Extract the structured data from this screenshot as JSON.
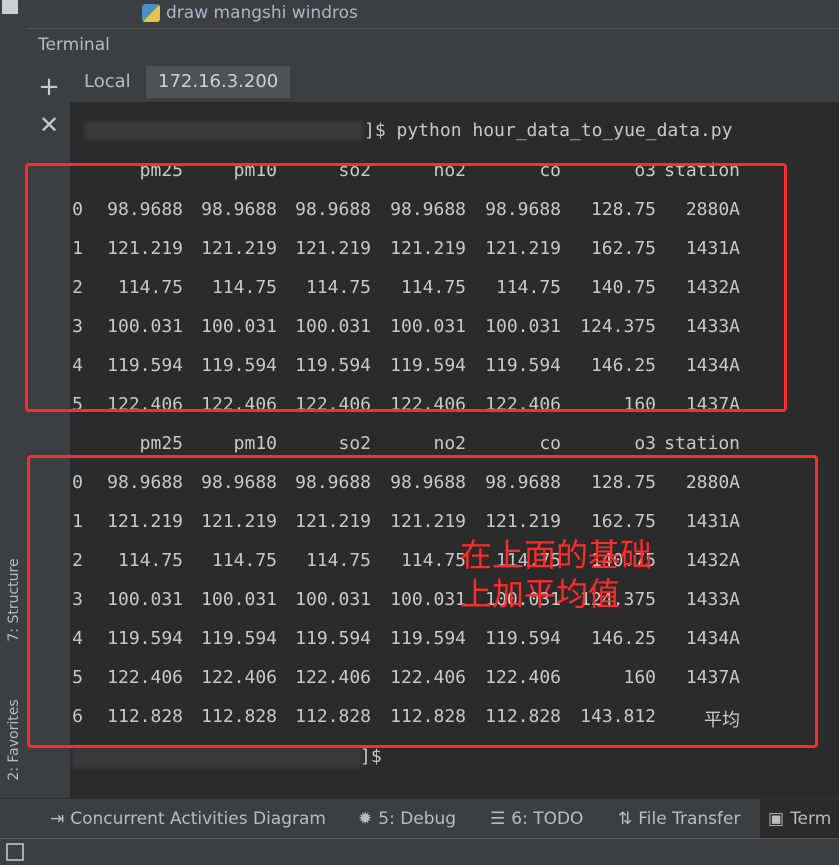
{
  "editor_tab": {
    "file": "draw mangshi windros"
  },
  "panel": {
    "title": "Terminal"
  },
  "side_labels": {
    "structure": "7: Structure",
    "favorites": "2: Favorites"
  },
  "tabs": [
    {
      "label": "Local"
    },
    {
      "label": "172.16.3.200"
    }
  ],
  "terminal": {
    "prompt_suffix": "]$",
    "command_line": "]$ python hour_data_to_yue_data.py",
    "columns": [
      "pm25",
      "pm10",
      "so2",
      "no2",
      "co",
      "o3",
      "station"
    ],
    "table1": [
      [
        "0",
        "98.9688",
        "98.9688",
        "98.9688",
        "98.9688",
        "98.9688",
        "128.75",
        "2880A"
      ],
      [
        "1",
        "121.219",
        "121.219",
        "121.219",
        "121.219",
        "121.219",
        "162.75",
        "1431A"
      ],
      [
        "2",
        "114.75",
        "114.75",
        "114.75",
        "114.75",
        "114.75",
        "140.75",
        "1432A"
      ],
      [
        "3",
        "100.031",
        "100.031",
        "100.031",
        "100.031",
        "100.031",
        "124.375",
        "1433A"
      ],
      [
        "4",
        "119.594",
        "119.594",
        "119.594",
        "119.594",
        "119.594",
        "146.25",
        "1434A"
      ],
      [
        "5",
        "122.406",
        "122.406",
        "122.406",
        "122.406",
        "122.406",
        "160",
        "1437A"
      ]
    ],
    "table2": [
      [
        "0",
        "98.9688",
        "98.9688",
        "98.9688",
        "98.9688",
        "98.9688",
        "128.75",
        "2880A"
      ],
      [
        "1",
        "121.219",
        "121.219",
        "121.219",
        "121.219",
        "121.219",
        "162.75",
        "1431A"
      ],
      [
        "2",
        "114.75",
        "114.75",
        "114.75",
        "114.75",
        "114.75",
        "140.75",
        "1432A"
      ],
      [
        "3",
        "100.031",
        "100.031",
        "100.031",
        "100.031",
        "100.031",
        "124.375",
        "1433A"
      ],
      [
        "4",
        "119.594",
        "119.594",
        "119.594",
        "119.594",
        "119.594",
        "146.25",
        "1434A"
      ],
      [
        "5",
        "122.406",
        "122.406",
        "122.406",
        "122.406",
        "122.406",
        "160",
        "1437A"
      ],
      [
        "6",
        "112.828",
        "112.828",
        "112.828",
        "112.828",
        "112.828",
        "143.812",
        "平均"
      ]
    ]
  },
  "annotation": {
    "text": "在上面的基础上加平均值"
  },
  "bottom_tools": [
    {
      "label": "Concurrent Activities Diagram",
      "icon": "diagram-icon"
    },
    {
      "label": "5: Debug",
      "icon": "bug-icon"
    },
    {
      "label": "6: TODO",
      "icon": "list-icon"
    },
    {
      "label": "File Transfer",
      "icon": "transfer-icon"
    },
    {
      "label": "Term",
      "icon": "terminal-icon"
    }
  ],
  "colors": {
    "annotation_red": "#ff2a2a",
    "terminal_bg": "#2b2b2b",
    "panel_bg": "#3c3f41"
  }
}
